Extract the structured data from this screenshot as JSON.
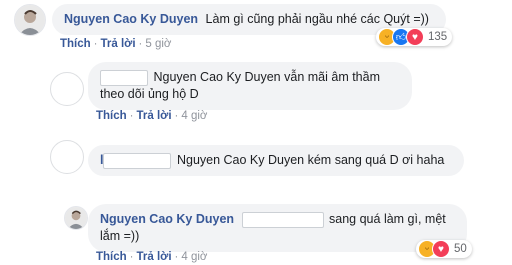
{
  "comments": [
    {
      "author": "Nguyen Cao Ky Duyen",
      "text": "Làm gì cũng phải ngầu nhé các Quýt =))",
      "actions": {
        "like": "Thích",
        "reply": "Trả lời",
        "time": "5 giờ"
      },
      "reaction_count": "135"
    },
    {
      "mention": "Nguyen Cao Ky Duyen",
      "text": "vẫn mãi âm thầm theo dõi ủng hộ D",
      "actions": {
        "like": "Thích",
        "reply": "Trả lời",
        "time": "4 giờ"
      }
    },
    {
      "author_initial": "l",
      "mention": "Nguyen Cao Ky Duyen",
      "text": "kém sang quá D ơi haha",
      "actions": {
        "like": "Thích",
        "reply": "Trả lời",
        "time": "4 giờ"
      }
    },
    {
      "author": "Nguyen Cao Ky Duyen",
      "text": "sang quá làm gì, mệt lắm =))",
      "actions": {
        "like": "Thích",
        "reply": "Trả lời",
        "time": "4 giờ"
      },
      "reaction_count": "50"
    }
  ],
  "separator": "·",
  "reaction_icons": [
    "haha-icon",
    "like-icon",
    "love-icon"
  ]
}
